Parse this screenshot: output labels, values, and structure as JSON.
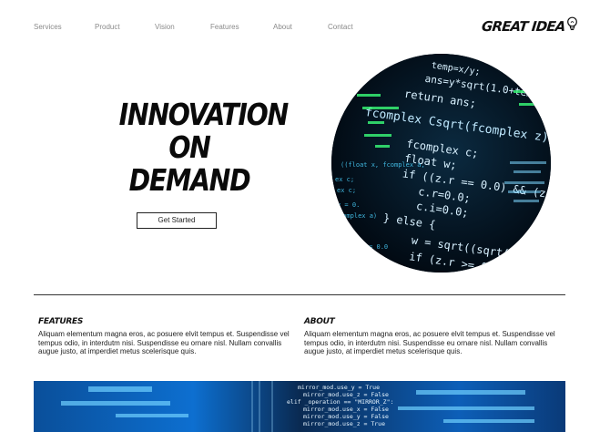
{
  "nav": {
    "items": [
      {
        "label": "Services"
      },
      {
        "label": "Product"
      },
      {
        "label": "Vision"
      },
      {
        "label": "Features"
      },
      {
        "label": "About"
      },
      {
        "label": "Contact"
      }
    ]
  },
  "logo": {
    "text": "GREAT IDEA",
    "icon": "lightbulb-icon"
  },
  "hero": {
    "title_line1": "INNOVATION",
    "title_line2": "ON",
    "title_line3": "DEMAND",
    "cta_label": "Get Started",
    "image": "code-screen-circle"
  },
  "features": {
    "heading": "FEATURES",
    "body": "Aliquam elementum magna eros, ac posuere elvit tempus et. Suspendisse vel tempus odio, in interdutm nisi. Suspendisse eu ornare nisl. Nullam convallis augue justo, at imperdiet metus scelerisque quis."
  },
  "about": {
    "heading": "ABOUT",
    "body": "Aliquam elementum magna eros, ac posuere elvit tempus et. Suspendisse vel tempus odio, in interdutm nisi. Suspendisse eu ornare nisl. Nullam convallis augue justo, at imperdiet metus scelerisque quis."
  },
  "colors": {
    "nav_text": "#8a8a8a",
    "code_bg": "#020b14",
    "code_text": "#d8f1ff",
    "code_accent": "#4bd3ff",
    "banner_blue": "#1a8cff"
  }
}
